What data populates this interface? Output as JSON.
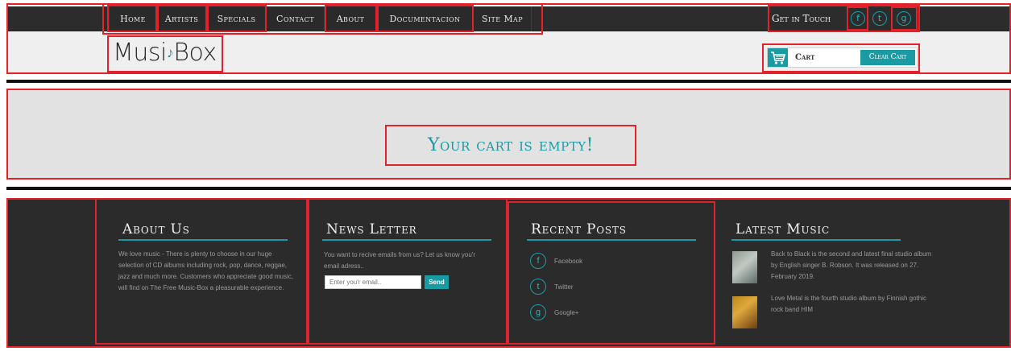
{
  "nav": {
    "items": [
      {
        "label": "Home"
      },
      {
        "label": "Artists"
      },
      {
        "label": "Specials"
      },
      {
        "label": "Contact"
      },
      {
        "label": "About"
      },
      {
        "label": "Documentacion"
      },
      {
        "label": "Site Map"
      }
    ],
    "get_in_touch": "Get in Touch",
    "social_icons": [
      "facebook-icon",
      "twitter-icon",
      "googleplus-icon"
    ],
    "social_glyphs": [
      "f",
      "t",
      "g"
    ]
  },
  "logo": {
    "text_part1": "Musi",
    "text_part2": "Box",
    "note_icon": "treble-clef-icon"
  },
  "cart": {
    "label": "Cart",
    "clear_label": "Clear Cart",
    "icon": "cart-icon"
  },
  "main": {
    "empty_message": "Your cart is empty!"
  },
  "footer": {
    "about": {
      "title": "About Us",
      "text": "We love music - There is plenty to choose in our huge selection of CD albums including rock, pop, dance, reggae, jazz and much more. Customers who appreciate good music, will find on The Free Music-Box a pleasurable experience."
    },
    "newsletter": {
      "title": "News Letter",
      "text": "You want to recive emails from us? Let us know you'r email adress..",
      "placeholder": "Enter you'r email..",
      "send_label": "Send"
    },
    "recent_posts": {
      "title": "Recent Posts",
      "items": [
        {
          "label": "Facebook",
          "glyph": "f"
        },
        {
          "label": "Twitter",
          "glyph": "t"
        },
        {
          "label": "Google+",
          "glyph": "g"
        }
      ]
    },
    "latest_music": {
      "title": "Latest Music",
      "items": [
        {
          "text": "Back to Black is the second and latest final studio album by English singer B. Robson. It was released on 27. February 2019."
        },
        {
          "text": "Love Metal is the fourth studio album by Finnish gothic rock band HIM"
        }
      ]
    }
  },
  "colors": {
    "accent": "#1a9aa3",
    "nav_bg": "#2c2c2c",
    "footer_bg": "#2b2b2b",
    "annotation_red": "#e3212b"
  }
}
